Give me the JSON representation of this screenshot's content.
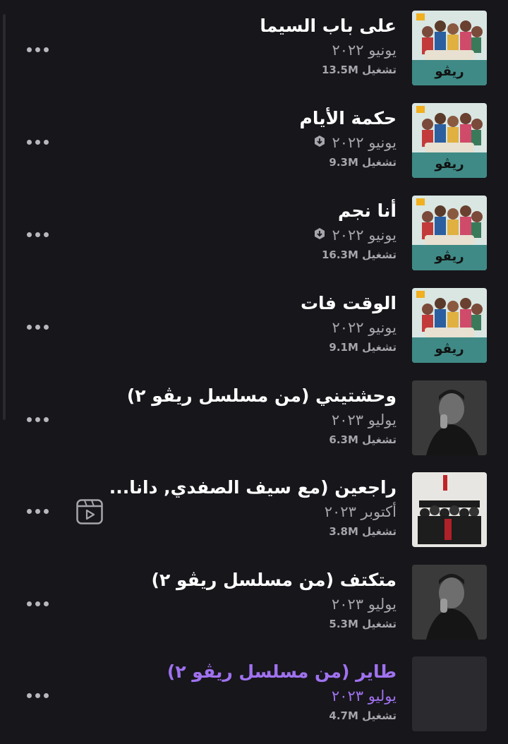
{
  "tracks": [
    {
      "title": "على باب السيما",
      "date": "يونيو ٢٠٢٢",
      "plays": "تشغيل 13.5M",
      "downloaded": false,
      "video": false,
      "cover": "rivo-cover"
    },
    {
      "title": "حكمة الأيام",
      "date": "يونيو ٢٠٢٢",
      "plays": "تشغيل 9.3M",
      "downloaded": true,
      "video": false,
      "cover": "rivo-cover"
    },
    {
      "title": "أنا نجم",
      "date": "يونيو ٢٠٢٢",
      "plays": "تشغيل 16.3M",
      "downloaded": true,
      "video": false,
      "cover": "rivo-cover"
    },
    {
      "title": "الوقت فات",
      "date": "يونيو ٢٠٢٢",
      "plays": "تشغيل 9.1M",
      "downloaded": false,
      "video": false,
      "cover": "rivo-cover"
    },
    {
      "title": "وحشتيني (من مسلسل ريڤو ٢)",
      "date": "يوليو ٢٠٢٣",
      "plays": "تشغيل 6.3M",
      "downloaded": false,
      "video": false,
      "cover": "portrait-cover"
    },
    {
      "title": "راجعين (مع سيف الصفدي, دانا...",
      "date": "أكتوبر ٢٠٢٣",
      "plays": "تشغيل 3.8M",
      "downloaded": false,
      "video": true,
      "cover": "group-cover"
    },
    {
      "title": "متكتف (من مسلسل ريڤو ٢)",
      "date": "يوليو ٢٠٢٣",
      "plays": "تشغيل 5.3M",
      "downloaded": false,
      "video": false,
      "cover": "portrait-cover"
    },
    {
      "title": "طاير (من مسلسل ريڤو ٢)",
      "date": "يوليو ٢٠٢٣",
      "plays": "تشغيل 4.7M",
      "downloaded": false,
      "video": false,
      "cover": "blank-cover",
      "active": true
    }
  ],
  "colors": {
    "background": "#17161b",
    "secondary_text": "#a6a5ab",
    "active_accent": "#9f72f0"
  },
  "icons": {
    "more": "more-options-icon",
    "download": "downloaded-icon",
    "video": "video-icon"
  }
}
